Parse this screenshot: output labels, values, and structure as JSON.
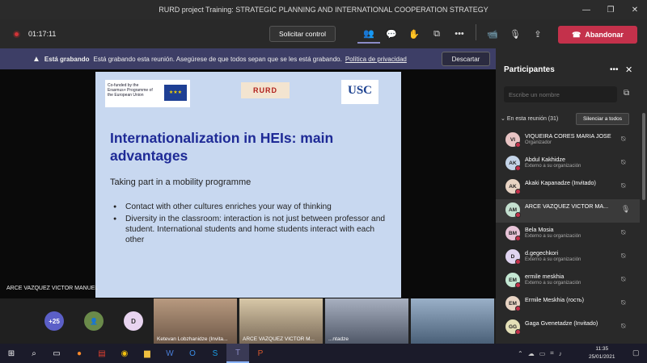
{
  "window": {
    "title": "RURD project Training: STRATEGIC PLANNING AND INTERNATIONAL COOPERATION STRATEGY",
    "minimize": "—",
    "maximize": "❐",
    "close": "✕"
  },
  "toolbar": {
    "timer": "01:17:11",
    "control_button": "Solicitar control",
    "leave_button": "Abandonar"
  },
  "banner": {
    "bold": "Está grabando",
    "text": "Está grabando esta reunión. Asegúrese de que todos sepan que se les está grabando.",
    "link": "Política de privacidad",
    "dismiss": "Descartar"
  },
  "slide": {
    "eu_logo": "Co-funded by the Erasmus+ Programme of the European Union",
    "rurd_logo": "RURD",
    "usc_logo": "USC",
    "title": "Internationalization in HEIs: main advantages",
    "subtitle": "Taking part in a mobility programme",
    "bullets": [
      "Contact with other cultures enriches your way of thinking",
      "Diversity in the classroom: interaction is not just between professor and student. International students and home students interact with each other"
    ]
  },
  "presenter_label": "ARCE VAZQUEZ VICTOR MANUEL",
  "strip": {
    "overflow": "+25",
    "d_avatar": "D",
    "videos": [
      {
        "label": "Ketevan Lobzhanidze (Invita..."
      },
      {
        "label": "ARCE VAZQUEZ VICTOR M..."
      },
      {
        "label": "...ntadze"
      },
      {
        "label": ""
      }
    ]
  },
  "panel": {
    "title": "Participantes",
    "invite_placeholder": "Escribe un nombre",
    "meeting_label": "En esta reunión (31)",
    "mute_all": "Silenciar a todos",
    "participants": [
      {
        "initials": "VI",
        "name": "VIQUEIRA CORES MARIA JOSE",
        "sub": "Organizador",
        "color": "#e8c4c4"
      },
      {
        "initials": "AK",
        "name": "Abdul Kakhidze",
        "sub": "Externo a su organización",
        "color": "#c4d4e8"
      },
      {
        "initials": "AK",
        "name": "Akaki Kapanadze (Invitado)",
        "sub": "",
        "color": "#e8d4c4"
      },
      {
        "initials": "AM",
        "name": "ARCE VAZQUEZ VICTOR MA...",
        "sub": "",
        "color": "#c4e0d0"
      },
      {
        "initials": "BM",
        "name": "Bela Mosia",
        "sub": "Externo a su organización",
        "color": "#e8c4d8"
      },
      {
        "initials": "D",
        "name": "d.gegechkori",
        "sub": "Externo a su organización",
        "color": "#e0d4f0"
      },
      {
        "initials": "EM",
        "name": "ermile meskhia",
        "sub": "Externo a su organización",
        "color": "#c4e8d4"
      },
      {
        "initials": "EM",
        "name": "Ermile Meskhia (гость)",
        "sub": "",
        "color": "#e8d4c4"
      },
      {
        "initials": "GG",
        "name": "Gaga Gvenetadze (Invitado)",
        "sub": "",
        "color": "#e4e0b8"
      }
    ]
  },
  "taskbar": {
    "time": "11:35",
    "date": "25/01/2021"
  }
}
